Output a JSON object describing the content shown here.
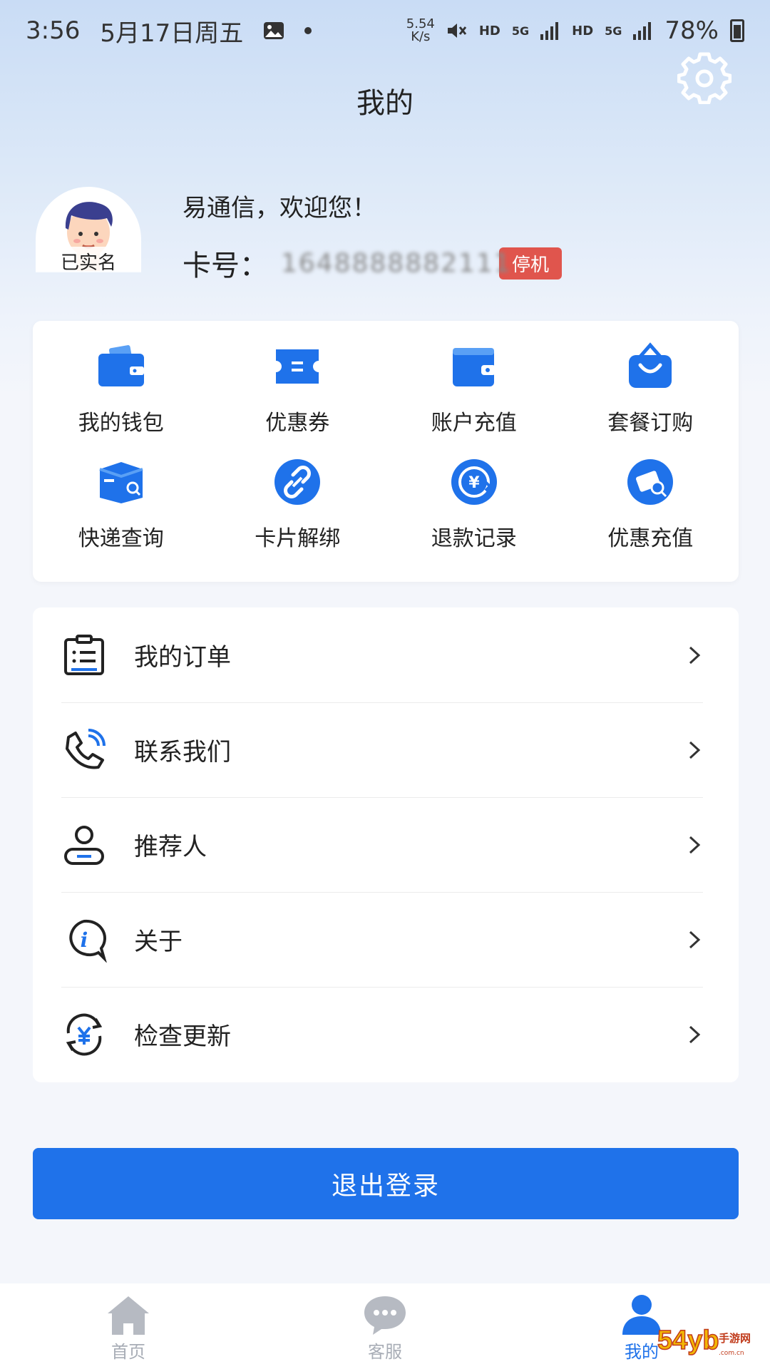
{
  "status_bar": {
    "time": "3:56",
    "date": "5月17日周五",
    "net_speed_top": "5.54",
    "net_speed_bottom": "K/s",
    "hd1": "HD",
    "sig1": "5G",
    "hd2": "HD",
    "sig2": "5G",
    "battery": "78%"
  },
  "header": {
    "title": "我的",
    "settings_icon": "gear-icon"
  },
  "profile": {
    "verified_label": "已实名",
    "welcome": "易通信，欢迎您！",
    "card_label": "卡号：",
    "card_number": "1648888882111",
    "status_badge": "停机"
  },
  "quick_actions": [
    {
      "label": "我的钱包",
      "icon": "wallet-icon"
    },
    {
      "label": "优惠券",
      "icon": "coupon-icon"
    },
    {
      "label": "账户充值",
      "icon": "account-topup-icon"
    },
    {
      "label": "套餐订购",
      "icon": "package-bag-icon"
    },
    {
      "label": "快递查询",
      "icon": "parcel-search-icon"
    },
    {
      "label": "卡片解绑",
      "icon": "unlink-icon"
    },
    {
      "label": "退款记录",
      "icon": "refund-icon"
    },
    {
      "label": "优惠充值",
      "icon": "discount-topup-icon"
    }
  ],
  "menu": [
    {
      "label": "我的订单",
      "icon": "order-list-icon"
    },
    {
      "label": "联系我们",
      "icon": "phone-icon"
    },
    {
      "label": "推荐人",
      "icon": "referrer-icon"
    },
    {
      "label": "关于",
      "icon": "info-icon"
    },
    {
      "label": "检查更新",
      "icon": "update-icon"
    }
  ],
  "logout": {
    "label": "退出登录"
  },
  "tabs": [
    {
      "label": "首页",
      "icon": "home-icon",
      "active": false
    },
    {
      "label": "客服",
      "icon": "chat-icon",
      "active": false
    },
    {
      "label": "我的",
      "icon": "user-icon",
      "active": true
    }
  ],
  "watermark": {
    "text": "54yb手游网",
    "url_text": "www.54yb.com.cn"
  },
  "colors": {
    "accent": "#1f72ea",
    "badge": "#e0554d",
    "tab_inactive": "#a8adb6"
  }
}
